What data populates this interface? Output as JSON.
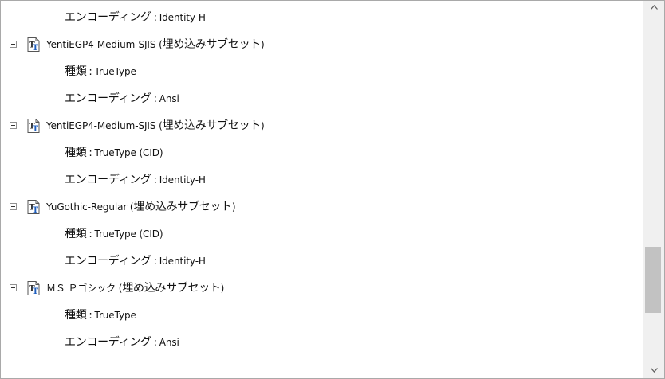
{
  "tree": {
    "rows": [
      {
        "kind": "prop",
        "label": "エンコーディング",
        "value": "Identity-H"
      },
      {
        "kind": "font",
        "name": "YentiEGP4-Medium-SJIS",
        "subset": "埋め込みサブセット"
      },
      {
        "kind": "prop",
        "label": "種類",
        "value": "TrueType"
      },
      {
        "kind": "prop",
        "label": "エンコーディング",
        "value": "Ansi"
      },
      {
        "kind": "font",
        "name": "YentiEGP4-Medium-SJIS",
        "subset": "埋め込みサブセット"
      },
      {
        "kind": "prop",
        "label": "種類",
        "value": "TrueType (CID)"
      },
      {
        "kind": "prop",
        "label": "エンコーディング",
        "value": "Identity-H"
      },
      {
        "kind": "font",
        "name": "YuGothic-Regular",
        "subset": "埋め込みサブセット"
      },
      {
        "kind": "prop",
        "label": "種類",
        "value": "TrueType (CID)"
      },
      {
        "kind": "prop",
        "label": "エンコーディング",
        "value": "Identity-H"
      },
      {
        "kind": "font",
        "name": "ＭＳ Ｐゴシック",
        "subset": "埋め込みサブセット"
      },
      {
        "kind": "prop",
        "label": "種類",
        "value": "TrueType"
      },
      {
        "kind": "prop",
        "label": "エンコーディング",
        "value": "Ansi"
      }
    ]
  },
  "scrollbar": {
    "position": 0.82,
    "visible_fraction": 0.19
  },
  "colors": {
    "icon_blue": "#1f5fbf",
    "icon_border": "#555555",
    "toggle_border": "#919191",
    "scroll_thumb": "#c2c2c2"
  }
}
